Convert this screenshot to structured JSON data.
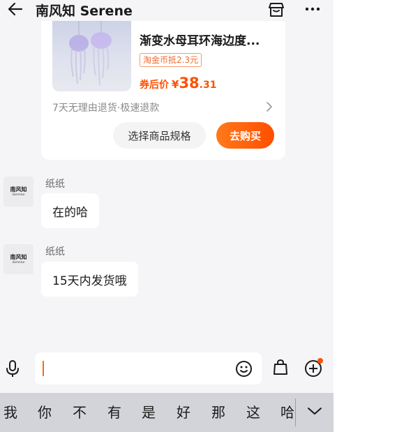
{
  "header": {
    "title": "南风知 Serene"
  },
  "product_card": {
    "name": "渐变水母耳环海边度...",
    "coin_badge": "淘金币抵2.3元",
    "price_label": "券后价",
    "price_symbol": "¥",
    "price_int": "38",
    "price_dec": ".31",
    "return_policy": "7天无理由退货·极速退款",
    "spec_button": "选择商品规格",
    "buy_button": "去购买"
  },
  "messages": [
    {
      "sender": "纸纸",
      "text": "在的哈",
      "avatar_line1": "南风知",
      "avatar_line2": "Serene"
    },
    {
      "sender": "纸纸",
      "text": "15天内发货哦",
      "avatar_line1": "南风知",
      "avatar_line2": "Serene"
    }
  ],
  "input": {
    "value": "",
    "placeholder": ""
  },
  "candidates": [
    "我",
    "你",
    "不",
    "有",
    "是",
    "好",
    "那",
    "这",
    "哈"
  ],
  "icons": {
    "back": "arrow-left-icon",
    "shop": "shop-icon",
    "more": "more-icon",
    "mic": "mic-icon",
    "emoji": "emoji-icon",
    "bag": "shopping-bag-icon",
    "plus": "plus-circle-icon",
    "collapse": "chevron-down-icon"
  },
  "colors": {
    "accent": "#ff5000",
    "background": "#f5f5f7",
    "keyboard_bar": "#d2d4d9"
  }
}
